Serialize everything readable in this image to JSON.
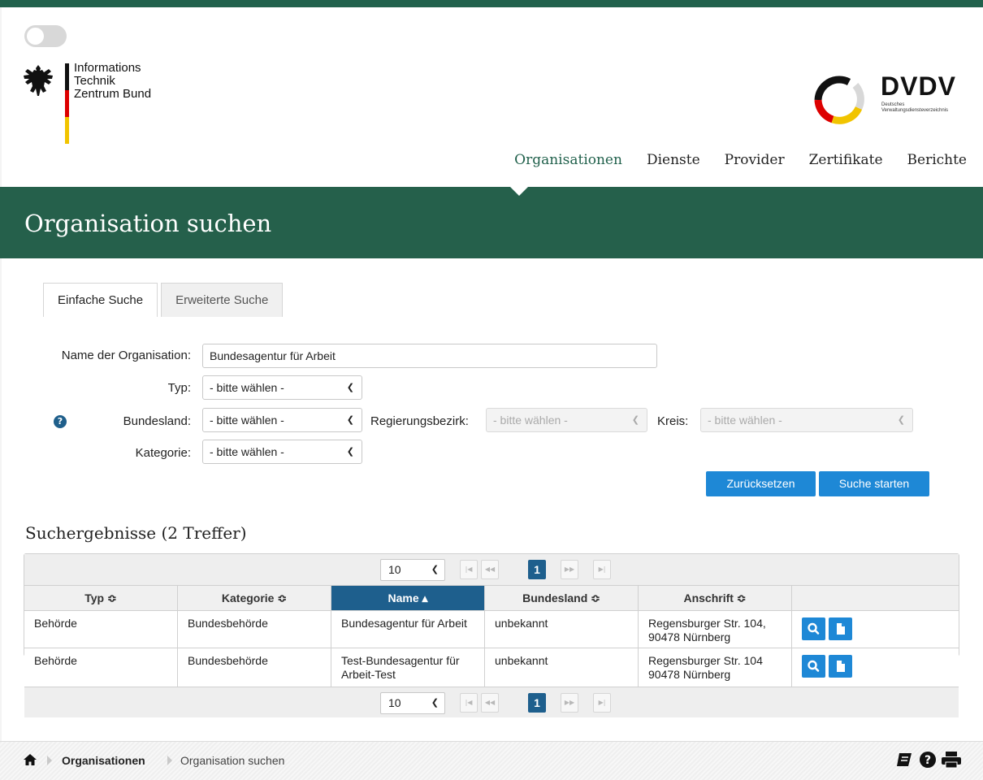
{
  "brand": {
    "itz_lines": [
      "Informations",
      "Technik",
      "Zentrum Bund"
    ],
    "dvdv_title": "DVDV",
    "dvdv_subtitle": [
      "Deutsches",
      "Verwaltungsdiensteverzeichnis"
    ],
    "accent_color": "#25604b",
    "button_color": "#1e88d6"
  },
  "nav": {
    "items": [
      "Organisationen",
      "Dienste",
      "Provider",
      "Zertifikate",
      "Berichte"
    ],
    "active": "Organisationen"
  },
  "page": {
    "title": "Organisation suchen"
  },
  "tabs": [
    "Einfache Suche",
    "Erweiterte Suche"
  ],
  "form": {
    "name_label": "Name der Organisation:",
    "name_value": "Bundesagentur für Arbeit",
    "typ_label": "Typ:",
    "typ_value": "- bitte wählen -",
    "bundesland_label": "Bundesland:",
    "bundesland_value": "- bitte wählen -",
    "regbez_label": "Regierungsbezirk:",
    "regbez_value": "- bitte wählen -",
    "kreis_label": "Kreis:",
    "kreis_value": "- bitte wählen -",
    "kategorie_label": "Kategorie:",
    "kategorie_value": "- bitte wählen -",
    "reset_button": "Zurücksetzen",
    "search_button": "Suche starten"
  },
  "results": {
    "title": "Suchergebnisse (2 Treffer)",
    "page_size": "10",
    "current_page": "1",
    "columns": [
      "Typ ≎",
      "Kategorie ≎",
      "Name ▴",
      "Bundesland ≎",
      "Anschrift ≎",
      ""
    ],
    "rows": [
      [
        "Behörde",
        "Bundesbehörde",
        "Bundesagentur für Arbeit",
        "unbekannt",
        "Regensburger Str. 104, 90478 Nürnberg"
      ],
      [
        "Behörde",
        "Bundesbehörde",
        "Test-Bundesagentur für Arbeit-Test",
        "unbekannt",
        "Regensburger Str. 104 90478 Nürnberg"
      ]
    ],
    "icons": [
      "search-icon",
      "document-icon"
    ]
  },
  "breadcrumb": {
    "items": [
      "Organisationen",
      "Organisation suchen"
    ],
    "icons": [
      "home-icon",
      "manual-icon",
      "help-icon",
      "print-icon"
    ]
  }
}
